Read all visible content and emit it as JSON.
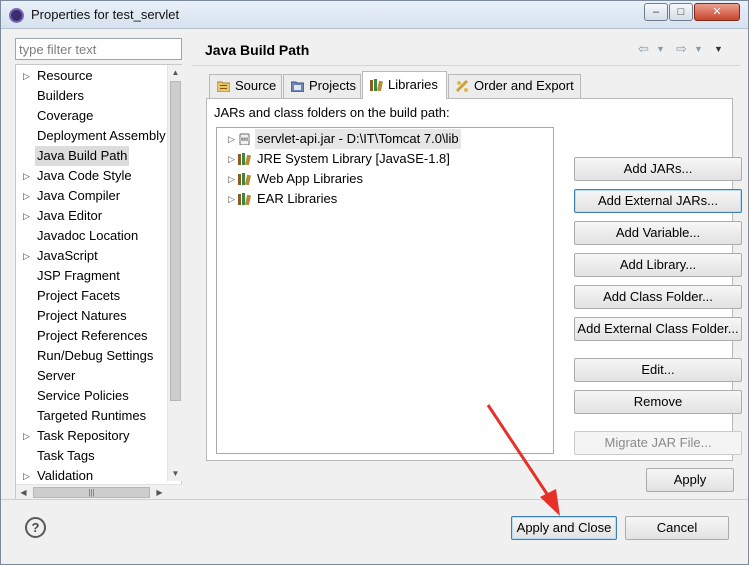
{
  "window": {
    "title": "Properties for test_servlet",
    "minimize_glyph": "–",
    "maximize_glyph": "□",
    "close_glyph": "✕"
  },
  "sidebar": {
    "filter_placeholder": "type filter text",
    "items": [
      {
        "label": "Resource",
        "expandable": true
      },
      {
        "label": "Builders",
        "expandable": false
      },
      {
        "label": "Coverage",
        "expandable": false
      },
      {
        "label": "Deployment Assembly",
        "expandable": false
      },
      {
        "label": "Java Build Path",
        "expandable": false,
        "selected": true
      },
      {
        "label": "Java Code Style",
        "expandable": true
      },
      {
        "label": "Java Compiler",
        "expandable": true
      },
      {
        "label": "Java Editor",
        "expandable": true
      },
      {
        "label": "Javadoc Location",
        "expandable": false
      },
      {
        "label": "JavaScript",
        "expandable": true
      },
      {
        "label": "JSP Fragment",
        "expandable": false
      },
      {
        "label": "Project Facets",
        "expandable": false
      },
      {
        "label": "Project Natures",
        "expandable": false
      },
      {
        "label": "Project References",
        "expandable": false
      },
      {
        "label": "Run/Debug Settings",
        "expandable": false
      },
      {
        "label": "Server",
        "expandable": false
      },
      {
        "label": "Service Policies",
        "expandable": false
      },
      {
        "label": "Targeted Runtimes",
        "expandable": false
      },
      {
        "label": "Task Repository",
        "expandable": true
      },
      {
        "label": "Task Tags",
        "expandable": false
      },
      {
        "label": "Validation",
        "expandable": true
      }
    ]
  },
  "main": {
    "title": "Java Build Path",
    "tabs": [
      {
        "label": "Source",
        "icon": "source-folder-icon"
      },
      {
        "label": "Projects",
        "icon": "projects-icon"
      },
      {
        "label": "Libraries",
        "icon": "libraries-icon",
        "active": true
      },
      {
        "label": "Order and Export",
        "icon": "order-export-icon"
      }
    ],
    "section_label": "JARs and class folders on the build path:",
    "libraries": [
      {
        "label": "servlet-api.jar - D:\\IT\\Tomcat 7.0\\lib",
        "icon": "jar-icon",
        "selected": true
      },
      {
        "label": "JRE System Library [JavaSE-1.8]",
        "icon": "library-icon"
      },
      {
        "label": "Web App Libraries",
        "icon": "library-icon"
      },
      {
        "label": "EAR Libraries",
        "icon": "library-icon"
      }
    ],
    "buttons": {
      "add_jars": "Add JARs...",
      "add_external_jars": "Add External JARs...",
      "add_variable": "Add Variable...",
      "add_library": "Add Library...",
      "add_class_folder": "Add Class Folder...",
      "add_external_class_folder": "Add External Class Folder...",
      "edit": "Edit...",
      "remove": "Remove",
      "migrate_jar": "Migrate JAR File..."
    },
    "apply": "Apply"
  },
  "footer": {
    "help": "?",
    "apply_and_close": "Apply and Close",
    "cancel": "Cancel"
  },
  "colors": {
    "annotation_arrow": "#e8302a",
    "selection": "#dcdcdc",
    "default_button_border": "#3c7fb1"
  }
}
